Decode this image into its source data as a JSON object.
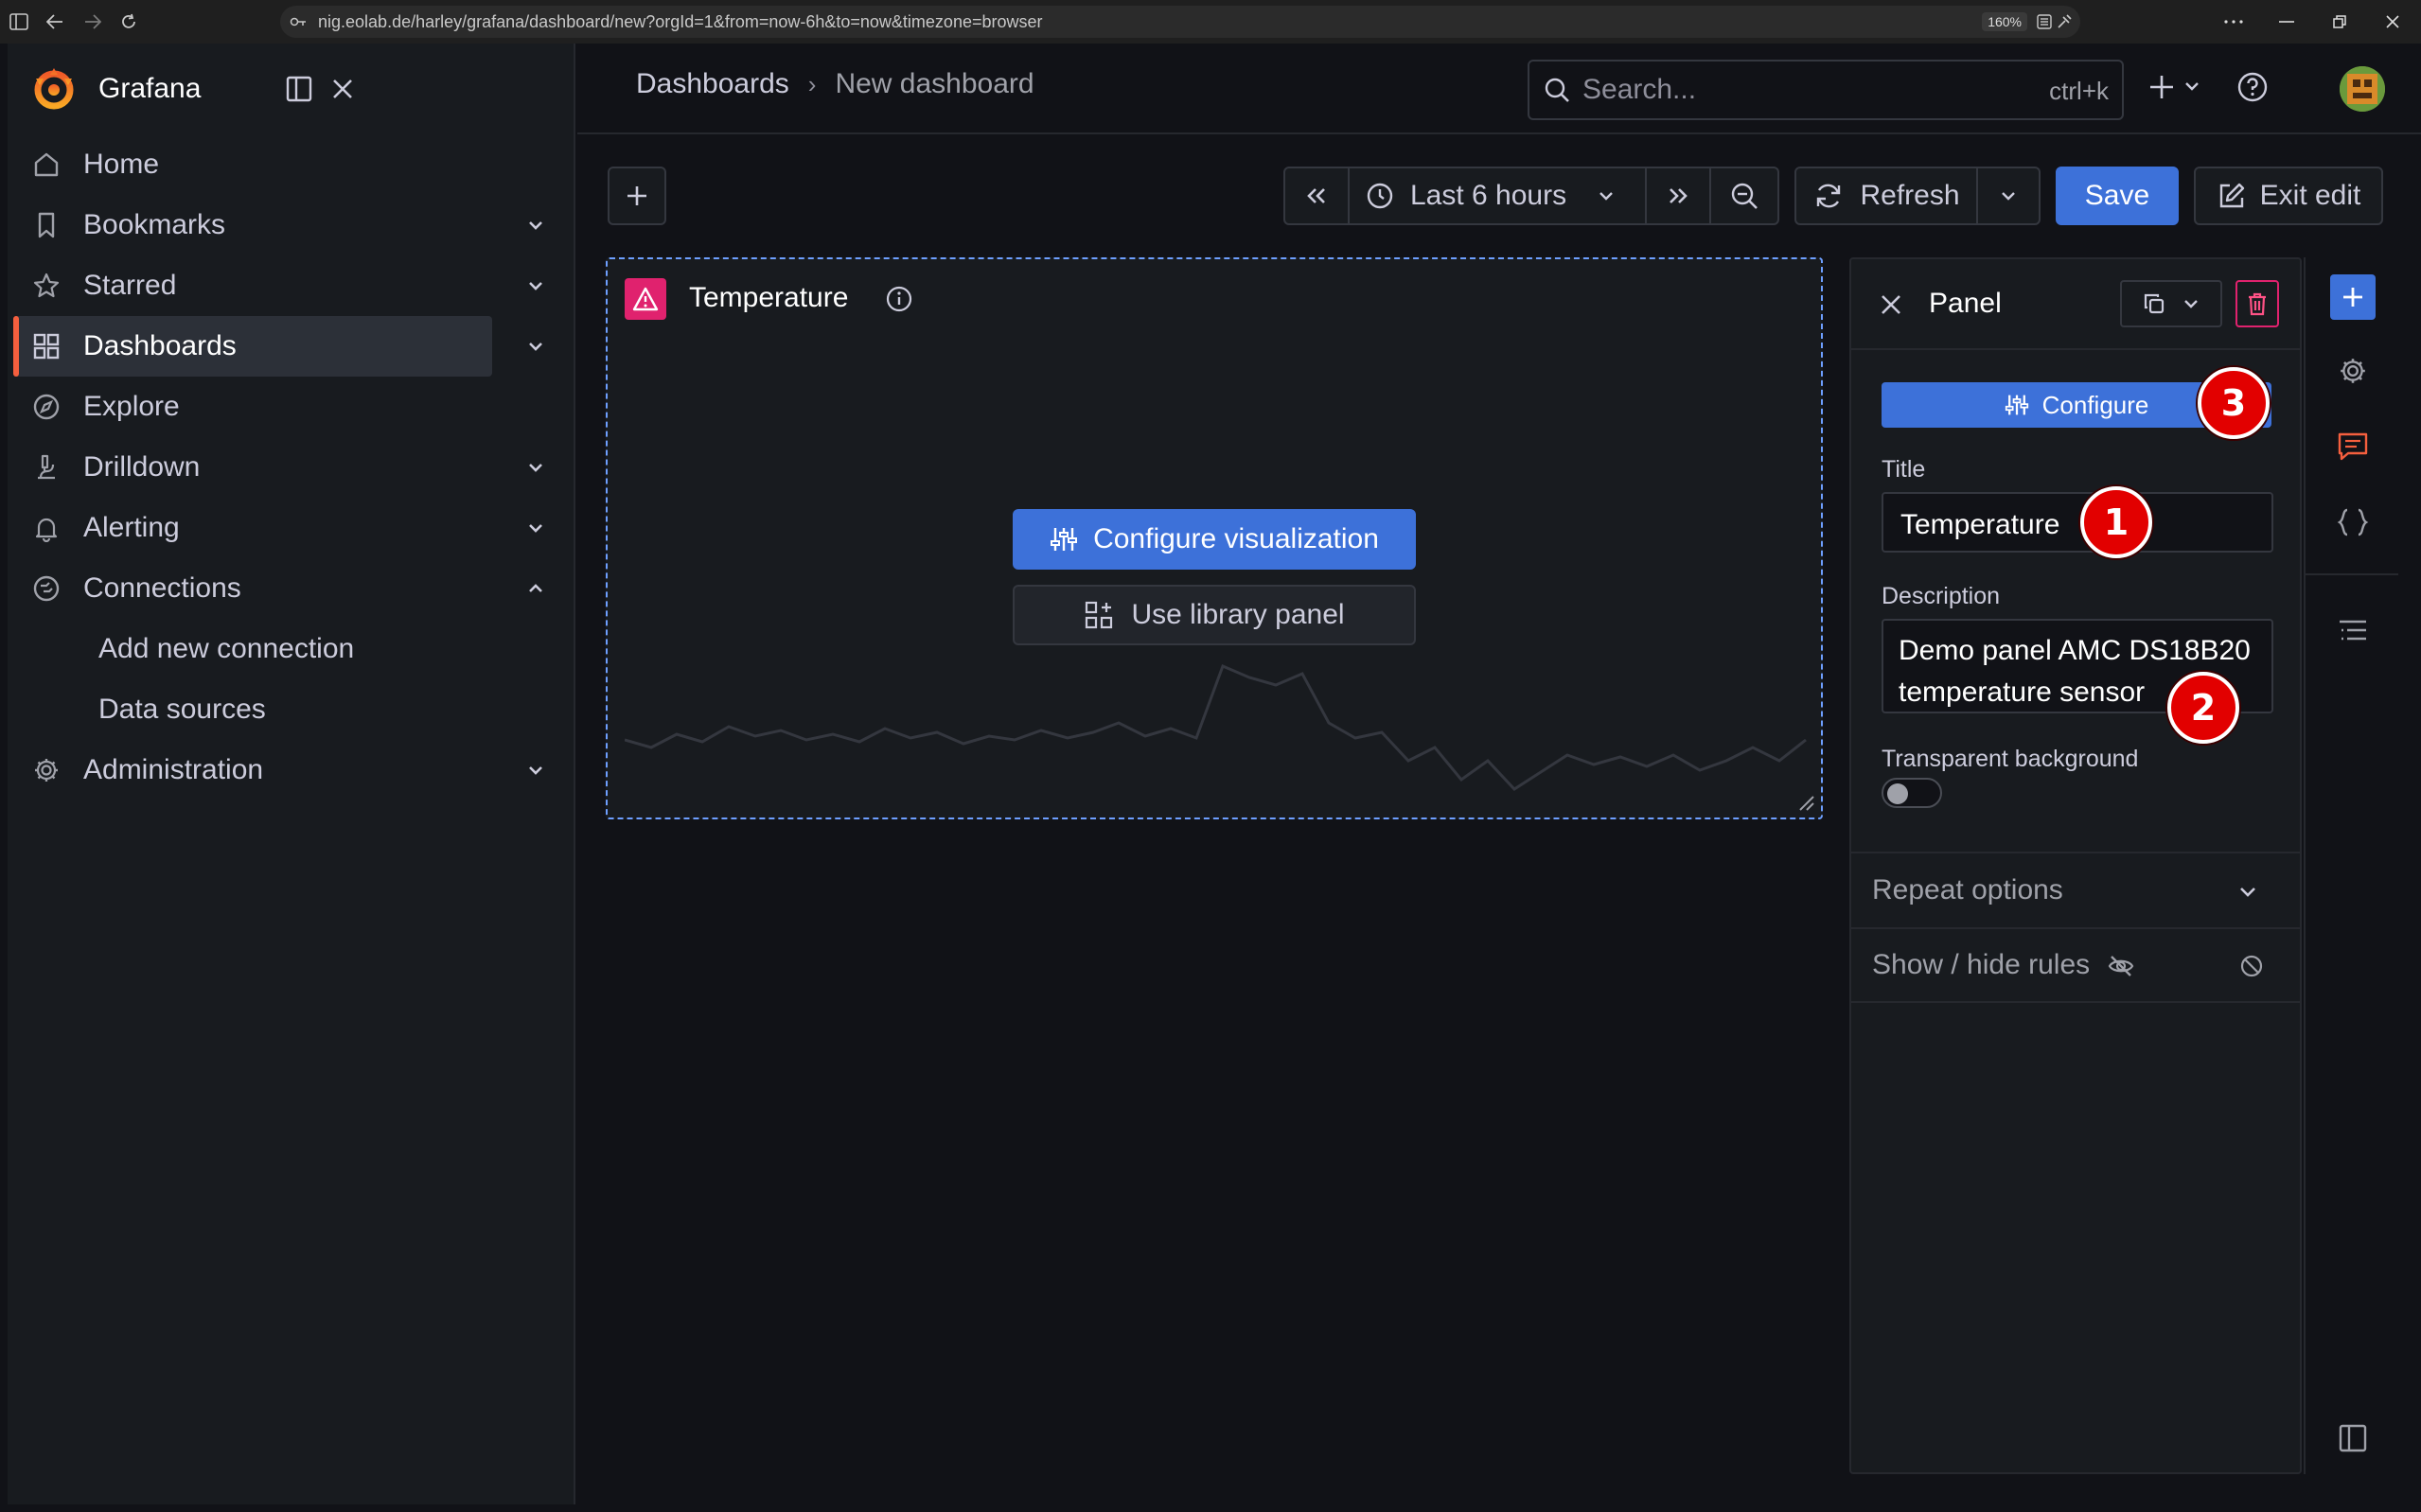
{
  "browser": {
    "url": "nig.eolab.de/harley/grafana/dashboard/new?orgId=1&from=now-6h&to=now&timezone=browser",
    "zoom": "160%"
  },
  "sidebar": {
    "brand": "Grafana",
    "items": [
      {
        "label": "Home",
        "icon": "home-icon"
      },
      {
        "label": "Bookmarks",
        "icon": "bookmark-icon"
      },
      {
        "label": "Starred",
        "icon": "star-icon"
      },
      {
        "label": "Dashboards",
        "icon": "apps-icon"
      },
      {
        "label": "Explore",
        "icon": "compass-icon"
      },
      {
        "label": "Drilldown",
        "icon": "microscope-icon"
      },
      {
        "label": "Alerting",
        "icon": "bell-icon"
      },
      {
        "label": "Connections",
        "icon": "plug-icon"
      },
      {
        "label": "Administration",
        "icon": "cog-icon"
      }
    ],
    "sub_items": [
      "Add new connection",
      "Data sources"
    ]
  },
  "header": {
    "breadcrumb_parent": "Dashboards",
    "breadcrumb_current": "New dashboard",
    "search_placeholder": "Search...",
    "search_shortcut": "ctrl+k"
  },
  "toolbar": {
    "time_range": "Last 6 hours",
    "refresh_label": "Refresh",
    "save_label": "Save",
    "exit_edit_label": "Exit edit"
  },
  "panel": {
    "title": "Temperature",
    "configure_viz_label": "Configure visualization",
    "library_panel_label": "Use library panel"
  },
  "edit_pane": {
    "header": "Panel",
    "configure_label": "Configure",
    "title_label": "Title",
    "title_value": "Temperature",
    "description_label": "Description",
    "description_value_line1": "Demo panel AMC DS18B20",
    "description_value_line2": "temperature sensor",
    "transparent_label": "Transparent background",
    "transparent_on": false,
    "repeat_options_label": "Repeat options",
    "show_hide_rules_label": "Show / hide rules"
  },
  "annotations": {
    "badge1": "1",
    "badge2": "2",
    "badge3": "3"
  },
  "colors": {
    "accent_blue": "#3d71d9",
    "brand_orange": "#f55f3e",
    "warning_pink": "#e0226e",
    "annotation_red": "#e20000"
  }
}
